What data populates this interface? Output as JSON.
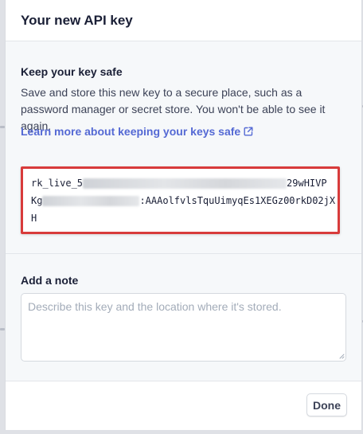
{
  "modal": {
    "title": "Your new API key"
  },
  "safety": {
    "heading": "Keep your key safe",
    "description": "Save and store this new key to a secure place, such as a password manager or secret store. You won't be able to see it again.",
    "link_label": "Learn more about keeping your keys safe"
  },
  "api_key": {
    "line1_prefix": "rk_live_5",
    "line1_suffix": "29wHIVP",
    "line2_prefix": "Kg",
    "line2_suffix": ":AAAolfvlsTquUimyqEs1XEGz00rkD02jX",
    "line3": "H"
  },
  "note": {
    "heading": "Add a note",
    "placeholder": "Describe this key and the location where it's stored.",
    "value": ""
  },
  "footer": {
    "done_label": "Done"
  },
  "colors": {
    "link": "#5469d4",
    "highlight_border": "#d83b3b",
    "text": "#1a1f36"
  }
}
